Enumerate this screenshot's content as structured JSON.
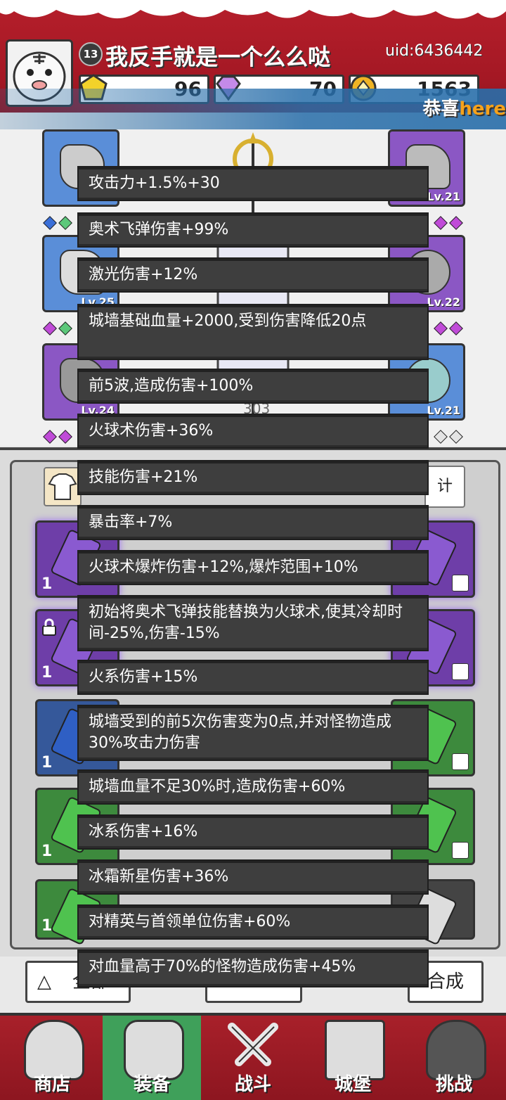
{
  "header": {
    "level": "13",
    "player_name": "我反手就是一个么么哒",
    "uid": "uid:6436442",
    "resources": [
      {
        "icon": "gold-gem-icon",
        "value": "96"
      },
      {
        "icon": "purple-diamond-icon",
        "value": "70"
      },
      {
        "icon": "gold-coin-icon",
        "value": "1563"
      }
    ]
  },
  "marquee": {
    "prefix": "恭喜",
    "highlight": "here"
  },
  "equip_slots": [
    {
      "side": "left",
      "color": "blue",
      "lv": ""
    },
    {
      "side": "left",
      "color": "blue",
      "lv": "Lv.25"
    },
    {
      "side": "left",
      "color": "purple",
      "lv": "Lv.24"
    },
    {
      "side": "right",
      "color": "purple",
      "lv": "Lv.21"
    },
    {
      "side": "right",
      "color": "purple",
      "lv": "Lv.22"
    },
    {
      "side": "right",
      "color": "blue",
      "lv": "Lv.21"
    }
  ],
  "hero_power": "303",
  "bag": {
    "tab_right_label": "计",
    "left_button_label": "全部",
    "right_button_label": "合成",
    "counts": [
      "1",
      "1",
      "1",
      "1",
      "1"
    ]
  },
  "tooltips": [
    "攻击力+1.5%+30",
    "奥术飞弹伤害+99%",
    "激光伤害+12%",
    "城墙基础血量+2000,受到伤害降低20点",
    "前5波,造成伤害+100%",
    "火球术伤害+36%",
    "技能伤害+21%",
    "暴击率+7%",
    "火球术爆炸伤害+12%,爆炸范围+10%",
    "初始将奥术飞弹技能替换为火球术,使其冷却时间-25%,伤害-15%",
    "火系伤害+15%",
    "城墙受到的前5次伤害变为0点,并对怪物造成30%攻击力伤害",
    "城墙血量不足30%时,造成伤害+60%",
    "冰系伤害+16%",
    "冰霜新星伤害+36%",
    "对精英与首领单位伤害+60%",
    "对血量高于70%的怪物造成伤害+45%"
  ],
  "nav": [
    {
      "label": "商店",
      "icon": "shop-icon"
    },
    {
      "label": "装备",
      "icon": "backpack-icon",
      "active": true
    },
    {
      "label": "战斗",
      "icon": "crossed-swords-icon"
    },
    {
      "label": "城堡",
      "icon": "castle-icon"
    },
    {
      "label": "挑战",
      "icon": "locked-challenge-icon"
    }
  ]
}
